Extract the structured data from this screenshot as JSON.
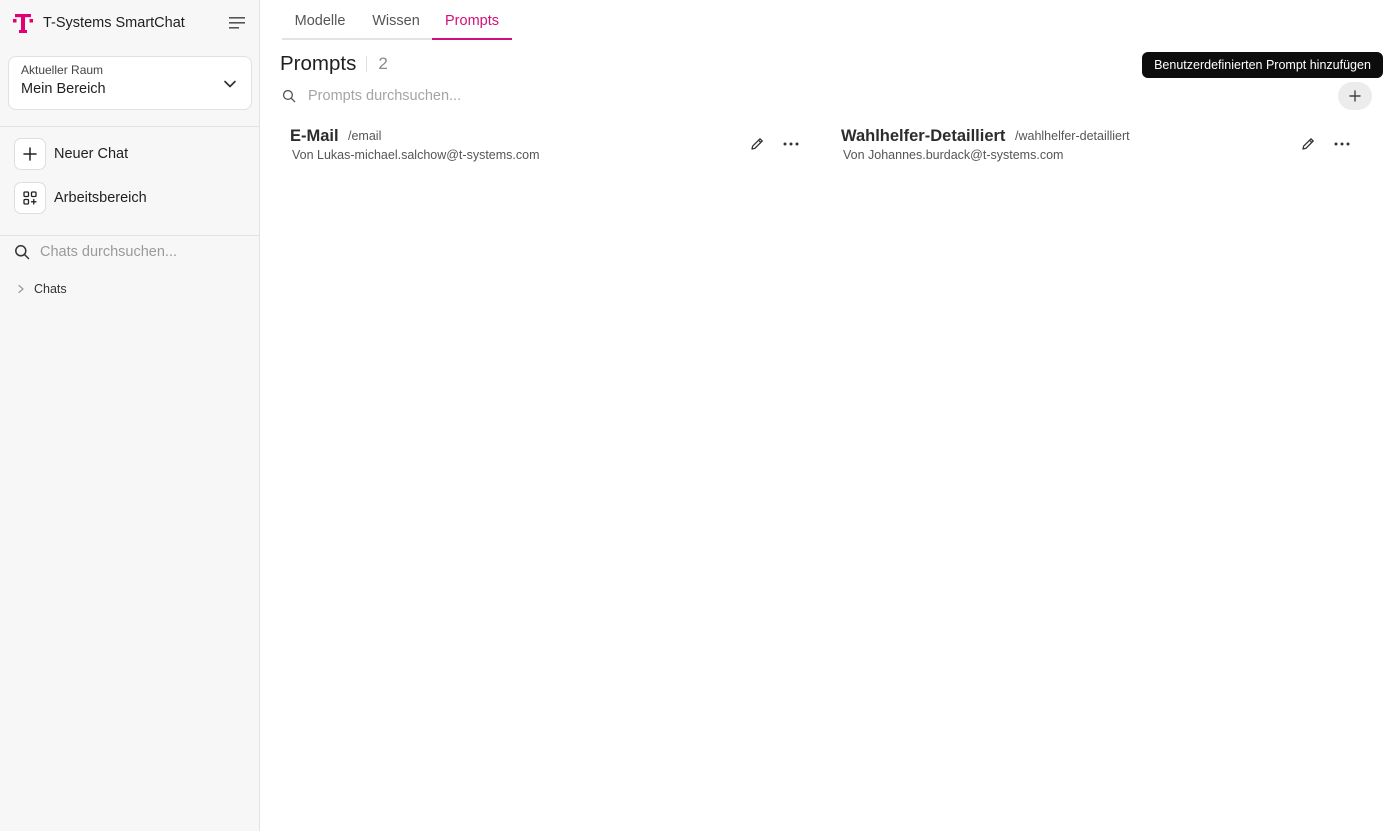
{
  "app": {
    "name": "T-Systems SmartChat",
    "brand_color": "#e20074",
    "logo_mark": "T"
  },
  "sidebar": {
    "room": {
      "label": "Aktueller Raum",
      "value": "Mein Bereich"
    },
    "actions": [
      {
        "label": "Neuer Chat",
        "icon": "plus-icon"
      },
      {
        "label": "Arbeitsbereich",
        "icon": "workspace-icon"
      }
    ],
    "search_placeholder": "Chats durchsuchen...",
    "folder": {
      "label": "Chats"
    }
  },
  "main": {
    "tabs": [
      {
        "label": "Modelle",
        "active": false
      },
      {
        "label": "Wissen",
        "active": false
      },
      {
        "label": "Prompts",
        "active": true
      }
    ],
    "title": "Prompts",
    "count": "2",
    "search_placeholder": "Prompts durchsuchen...",
    "add_tooltip": "Benutzerdefinierten Prompt hinzufügen",
    "prompts": [
      {
        "name": "E-Mail",
        "command": "/email",
        "author": "Von Lukas-michael.salchow@t-systems.com"
      },
      {
        "name": "Wahlhelfer-Detailliert",
        "command": "/wahlhelfer-detailliert",
        "author": "Von Johannes.burdack@t-systems.com"
      }
    ]
  }
}
